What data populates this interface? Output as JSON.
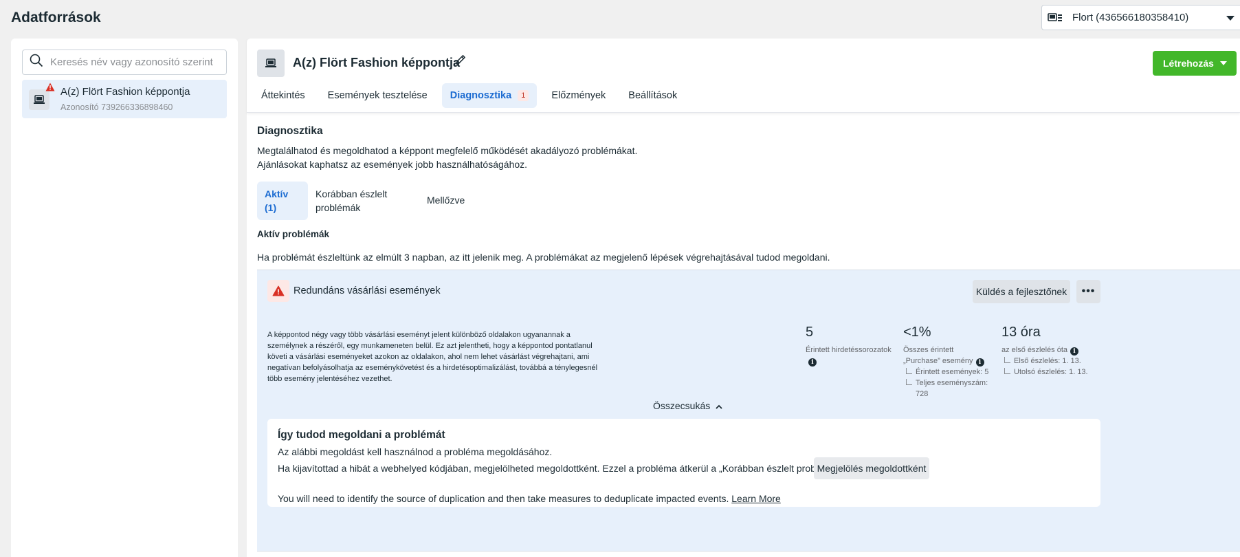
{
  "page": {
    "title": "Adatforrások"
  },
  "account": {
    "label": "Flort (436566180358410)"
  },
  "sidebar": {
    "search_placeholder": "Keresés név vagy azonosító szerint",
    "items": [
      {
        "name": "A(z) Flört Fashion képpontja",
        "id_text": "Azonosító 739266336898460"
      }
    ]
  },
  "header": {
    "pixel_title": "A(z) Flört Fashion képpontja",
    "create_label": "Létrehozás",
    "tabs": [
      {
        "label": "Áttekintés"
      },
      {
        "label": "Események tesztelése"
      },
      {
        "label": "Diagnosztika",
        "count": "1"
      },
      {
        "label": "Előzmények"
      },
      {
        "label": "Beállítások"
      }
    ]
  },
  "diagnostics": {
    "title": "Diagnosztika",
    "desc_line1": "Megtalálhatod és megoldhatod a képpont megfelelő működését akadályozó problémákat.",
    "desc_line2": "Ajánlásokat kaphatsz az események jobb használhatóságához.",
    "subtabs": {
      "active": "Aktív (1)",
      "previous": "Korábban észlelt problémák",
      "ignored": "Mellőzve"
    },
    "active_title": "Aktív problémák",
    "active_desc": "Ha problémát észleltünk az elmúlt 3 napban, az itt jelenik meg. A problémákat az megjelenő lépések végrehajtásával tudod megoldani."
  },
  "issue": {
    "title": "Redundáns vásárlási események",
    "send_label": "Küldés a fejlesztőnek",
    "more_label": "•••",
    "description": "A képpontod négy vagy több vásárlási eseményt jelent különböző oldalakon ugyanannak a személynek a részéről, egy munkameneten belül. Ez azt jelentheti, hogy a képpontod pontatlanul követi a vásárlási eseményeket azokon az oldalakon, ahol nem lehet vásárlást végrehajtani, ami negatívan befolyásolhatja az eseménykövetést és a hirdetésoptimalizálást, továbbá a ténylegesnél több esemény jelentéséhez vezethet.",
    "metrics": {
      "adsets": {
        "value": "5",
        "label": "Érintett hirdetéssorozatok"
      },
      "events": {
        "value": "<1%",
        "label1": "Összes érintett",
        "label2": "„Purchase” esemény",
        "sub1": "Érintett események: 5",
        "sub2": "Teljes eseményszám: 728"
      },
      "time": {
        "value": "13 óra",
        "label": "az első észlelés óta",
        "sub1": "Első észlelés: 1. 13.",
        "sub2": "Utolsó észlelés: 1. 13."
      }
    },
    "collapse_label": "Összecsukás",
    "solve": {
      "title": "Így tudod megoldani a problémát",
      "line1": "Az alábbi megoldást kell használnod a probléma megoldásához.",
      "line2": "Ha kijavítottad a hibát a webhelyed kódjában, megjelölheted megoldottként. Ezzel a probléma átkerül a „Korábban észlelt problémák” területre.",
      "resolve_label": "Megjelölés megoldottként",
      "line3": "You will need to identify the source of duplication and then take measures to deduplicate impacted events.",
      "learn_more": "Learn More"
    }
  },
  "colors": {
    "accent": "#1b6bd1",
    "create": "#42b72a",
    "warning": "#d93025",
    "card_bg": "#e7f0fb"
  }
}
